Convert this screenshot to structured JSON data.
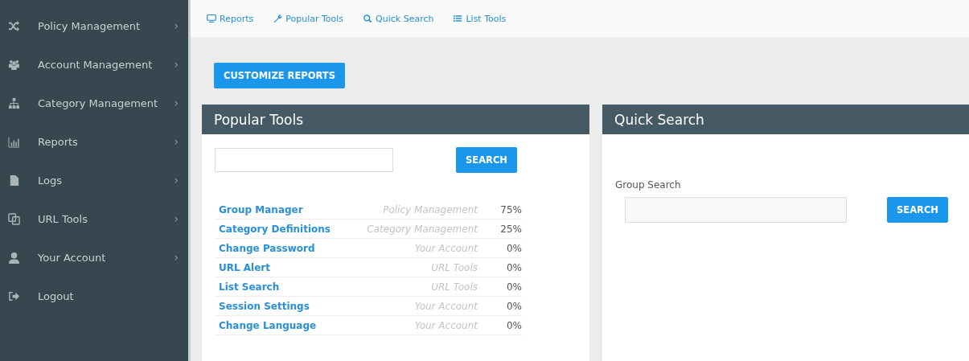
{
  "sidebar": {
    "items": [
      {
        "label": "Policy Management",
        "arrow": "›"
      },
      {
        "label": "Account Management",
        "arrow": "›"
      },
      {
        "label": "Category Management",
        "arrow": "›"
      },
      {
        "label": "Reports",
        "arrow": "›"
      },
      {
        "label": "Logs",
        "arrow": "›"
      },
      {
        "label": "URL Tools",
        "arrow": "›"
      },
      {
        "label": "Your Account",
        "arrow": "›"
      },
      {
        "label": "Logout"
      }
    ]
  },
  "top_nav": [
    "Reports",
    "Popular Tools",
    "Quick Search",
    "List Tools"
  ],
  "customize_button": "CUSTOMIZE REPORTS",
  "popular_tools": {
    "title": "Popular Tools",
    "search_button": "SEARCH",
    "rows": [
      {
        "tool": "Group Manager",
        "section": "Policy Management",
        "share": "75%"
      },
      {
        "tool": "Category Definitions",
        "section": "Category Management",
        "share": "25%"
      },
      {
        "tool": "Change Password",
        "section": "Your Account",
        "share": "0%"
      },
      {
        "tool": "URL Alert",
        "section": "URL Tools",
        "share": "0%"
      },
      {
        "tool": "List Search",
        "section": "URL Tools",
        "share": "0%"
      },
      {
        "tool": "Session Settings",
        "section": "Your Account",
        "share": "0%"
      },
      {
        "tool": "Change Language",
        "section": "Your Account",
        "share": "0%"
      }
    ]
  },
  "quick_search": {
    "title": "Quick Search",
    "label": "Group Search",
    "search_button": "SEARCH"
  }
}
